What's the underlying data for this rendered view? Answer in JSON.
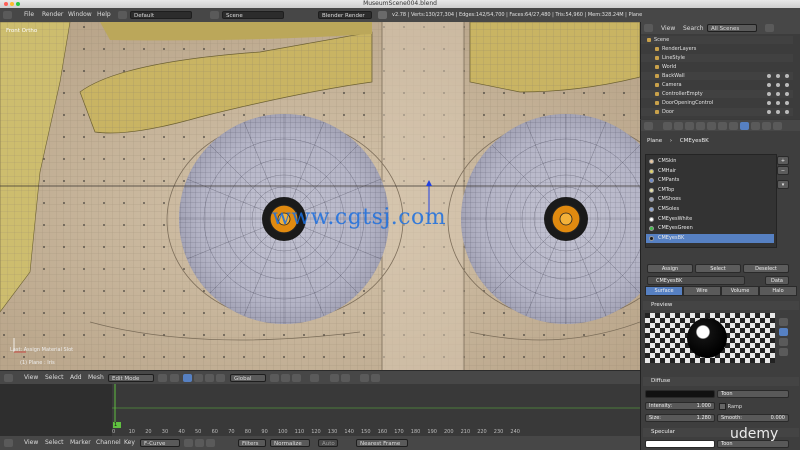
{
  "window": {
    "title": "MuseumScene004.blend"
  },
  "info_header": {
    "menus": [
      "File",
      "Render",
      "Window",
      "Help"
    ],
    "screen_layout": "Default",
    "scene": "Scene",
    "render_engine": "Blender Render",
    "stats": "v2.78 | Verts:130/27,304 | Edges:142/54,700 | Faces:64/27,480 | Tris:54,960 | Mem:328.24M | Plane"
  },
  "viewport": {
    "view_label": "Front Ortho",
    "last_operator": "Last: Assign Material Slot",
    "object_label": "(1) Plane : Iris",
    "watermark": "www.cgtsj.com"
  },
  "view3d_header": {
    "menus": [
      "View",
      "Select",
      "Add",
      "Mesh"
    ],
    "mode": "Edit Mode",
    "pivot": "Global"
  },
  "timeline": {
    "ticks": [
      "0",
      "10",
      "20",
      "30",
      "40",
      "50",
      "60",
      "70",
      "80",
      "90",
      "100",
      "110",
      "120",
      "130",
      "140",
      "150",
      "160",
      "170",
      "180",
      "190",
      "200",
      "210",
      "220",
      "230",
      "240"
    ],
    "current_frame": "1"
  },
  "graph_header": {
    "menus": [
      "View",
      "Select",
      "Marker",
      "Channel",
      "Key"
    ],
    "editor": "F-Curve",
    "filters": "Filters",
    "normalize": "Normalize",
    "auto": "Auto",
    "snap": "Nearest Frame"
  },
  "outliner": {
    "menus": [
      "View",
      "Search"
    ],
    "filter": "All Scenes",
    "items": [
      {
        "label": "Scene",
        "indent": 0
      },
      {
        "label": "RenderLayers",
        "indent": 1
      },
      {
        "label": "LineStyle",
        "indent": 1
      },
      {
        "label": "World",
        "indent": 1
      },
      {
        "label": "BackWall",
        "indent": 1
      },
      {
        "label": "Camera",
        "indent": 1
      },
      {
        "label": "ControllerEmpty",
        "indent": 1
      },
      {
        "label": "DoorOpeningControl",
        "indent": 1
      },
      {
        "label": "Door",
        "indent": 1
      }
    ]
  },
  "properties": {
    "breadcrumb": [
      "Plane",
      "CMEyesBK"
    ],
    "materials": [
      {
        "label": "CMSkin",
        "color": "#e8c9a2"
      },
      {
        "label": "CMHair",
        "color": "#e0d26a"
      },
      {
        "label": "CMPants",
        "color": "#6b88c9"
      },
      {
        "label": "CMTop",
        "color": "#e7e1a8"
      },
      {
        "label": "CMShoes",
        "color": "#9aa0b8"
      },
      {
        "label": "CMSoles",
        "color": "#8ea6d8"
      },
      {
        "label": "CMEyesWhite",
        "color": "#ffffff"
      },
      {
        "label": "CMEyesGreen",
        "color": "#3fbf4a"
      },
      {
        "label": "CMEyesBK",
        "color": "#1a1a1a"
      }
    ],
    "selected_material": "CMEyesBK",
    "assign": "Assign",
    "select": "Select",
    "deselect": "Deselect",
    "material_field": "CMEyesBK",
    "data_label": "Data",
    "context_tabs": [
      "Surface",
      "Wire",
      "Volume",
      "Halo"
    ],
    "active_tab": "Surface",
    "preview_label": "Preview",
    "diffuse_label": "Diffuse",
    "diffuse_shader": "Toon",
    "intensity_label": "Intensity:",
    "intensity_value": "1.000",
    "ramp_label": "Ramp",
    "size_label": "Size:",
    "size_value": "1.280",
    "smooth_label": "Smooth:",
    "smooth_value": "0.000",
    "specular_label": "Specular",
    "specular_shader": "Toon"
  },
  "overlay": {
    "udemy": "udemy"
  },
  "colors": {
    "accent": "#5680c2",
    "iris": "#e08a10",
    "timeline_cursor": "#60c040"
  }
}
